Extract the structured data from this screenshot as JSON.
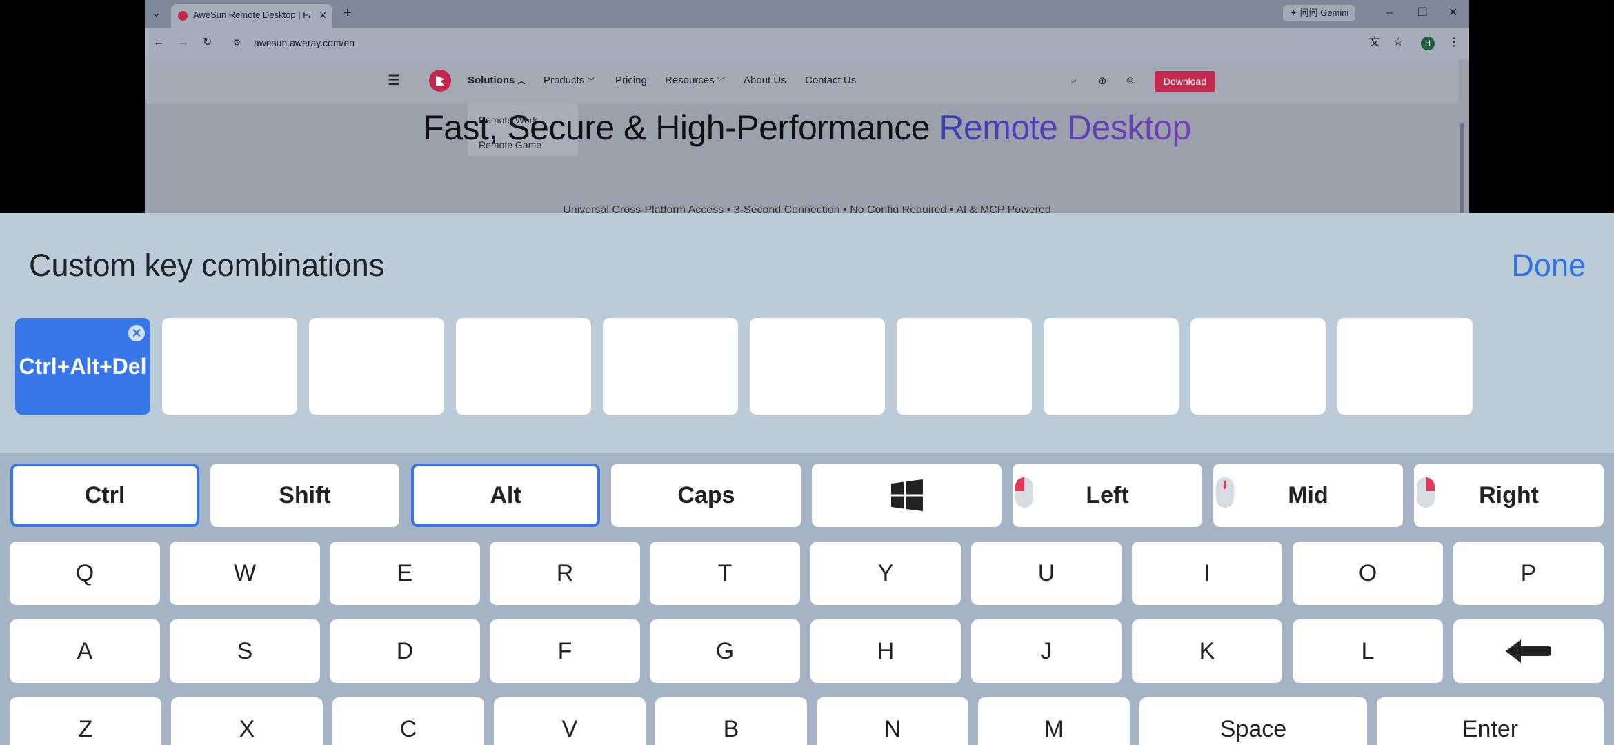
{
  "browser": {
    "tab_title": "AweSun Remote Desktop | Fa",
    "gemini_label": "问问 Gemini",
    "url": "awesun.aweray.com/en",
    "profile_initial": "H"
  },
  "site": {
    "nav": [
      "Solutions",
      "Products",
      "Pricing",
      "Resources",
      "About Us",
      "Contact Us"
    ],
    "download": "Download",
    "dropdown": [
      "Remote Work",
      "Remote Game"
    ],
    "hero_title_main": "Fast, Secure & High-Performance ",
    "hero_title_accent": "Remote Desktop",
    "hero_subtitle": "Universal Cross-Platform Access • 3-Second Connection • No Config Required • AI & MCP Powered"
  },
  "panel": {
    "title": "Custom key combinations",
    "done": "Done",
    "slots": [
      "Ctrl+Alt+Del",
      "",
      "",
      "",
      "",
      "",
      "",
      "",
      "",
      ""
    ]
  },
  "keyboard": {
    "modifiers": [
      {
        "label": "Ctrl",
        "selected": true
      },
      {
        "label": "Shift",
        "selected": false
      },
      {
        "label": "Alt",
        "selected": true
      },
      {
        "label": "Caps",
        "selected": false
      },
      {
        "label": "",
        "icon": "windows-icon",
        "selected": false
      },
      {
        "label": "Left",
        "icon": "mouse-left-icon",
        "selected": false
      },
      {
        "label": "Mid",
        "icon": "mouse-middle-icon",
        "selected": false
      },
      {
        "label": "Right",
        "icon": "mouse-right-icon",
        "selected": false
      }
    ],
    "row1": [
      "Q",
      "W",
      "E",
      "R",
      "T",
      "Y",
      "U",
      "I",
      "O",
      "P"
    ],
    "row2": [
      "A",
      "S",
      "D",
      "F",
      "G",
      "H",
      "J",
      "K",
      "L"
    ],
    "row2_backspace_icon": "backspace-arrow-icon",
    "row3": [
      "Z",
      "X",
      "C",
      "V",
      "B",
      "N",
      "M",
      "Space",
      "Enter"
    ]
  },
  "colors": {
    "accent": "#3776e6",
    "panel_bg": "#bccbd8",
    "keyboard_bg": "#a4b4c4",
    "download_red": "#c22a4e"
  }
}
